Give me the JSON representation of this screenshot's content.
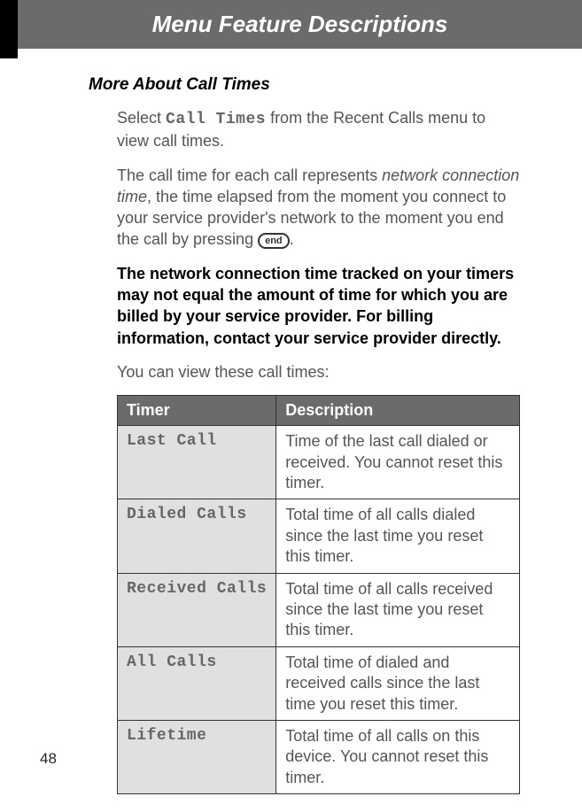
{
  "header": {
    "title": "Menu Feature Descriptions"
  },
  "section": {
    "title": "More About Call Times",
    "intro_prefix": "Select ",
    "intro_mono": "Call Times",
    "intro_suffix": " from the Recent Calls menu to view call times.",
    "para2_a": "The call time for each call represents ",
    "para2_italic": "network connection time",
    "para2_b": ", the time elapsed from the moment you connect to your service provider's network to the moment you end the call by pressing ",
    "para2_c": ".",
    "end_label": "end",
    "bold_note": "The network connection time tracked on your timers may not equal the amount of time for which you are billed by your service provider. For billing information, contact your service provider directly.",
    "para3": "You can view these call times:"
  },
  "table": {
    "headers": {
      "timer": "Timer",
      "description": "Description"
    },
    "rows": [
      {
        "timer": "Last Call",
        "description": "Time of the last call dialed or received. You cannot reset this timer."
      },
      {
        "timer": "Dialed Calls",
        "description": "Total time of all calls dialed since the last time you reset this timer."
      },
      {
        "timer": "Received Calls",
        "description": "Total time of all calls received since the last time you reset this timer."
      },
      {
        "timer": "All Calls",
        "description": "Total time of dialed and received calls since the last time you reset this timer."
      },
      {
        "timer": "Lifetime",
        "description": "Total time of all calls on this device. You cannot reset this timer."
      }
    ]
  },
  "page_number": "48"
}
